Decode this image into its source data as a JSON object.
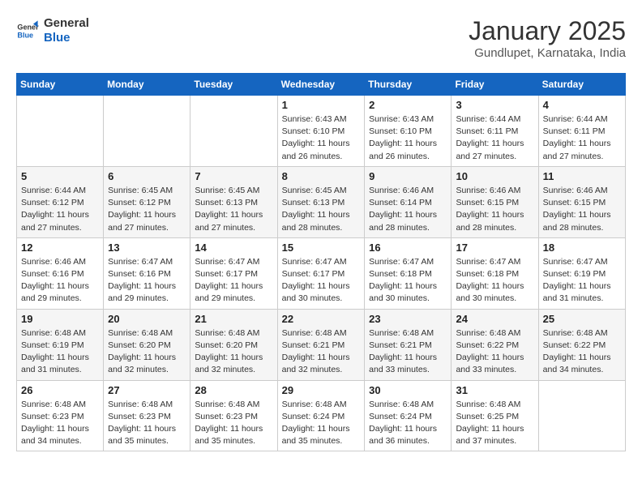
{
  "logo": {
    "line1": "General",
    "line2": "Blue"
  },
  "title": "January 2025",
  "subtitle": "Gundlupet, Karnataka, India",
  "days_of_week": [
    "Sunday",
    "Monday",
    "Tuesday",
    "Wednesday",
    "Thursday",
    "Friday",
    "Saturday"
  ],
  "weeks": [
    [
      {
        "day": "",
        "info": ""
      },
      {
        "day": "",
        "info": ""
      },
      {
        "day": "",
        "info": ""
      },
      {
        "day": "1",
        "info": "Sunrise: 6:43 AM\nSunset: 6:10 PM\nDaylight: 11 hours and 26 minutes."
      },
      {
        "day": "2",
        "info": "Sunrise: 6:43 AM\nSunset: 6:10 PM\nDaylight: 11 hours and 26 minutes."
      },
      {
        "day": "3",
        "info": "Sunrise: 6:44 AM\nSunset: 6:11 PM\nDaylight: 11 hours and 27 minutes."
      },
      {
        "day": "4",
        "info": "Sunrise: 6:44 AM\nSunset: 6:11 PM\nDaylight: 11 hours and 27 minutes."
      }
    ],
    [
      {
        "day": "5",
        "info": "Sunrise: 6:44 AM\nSunset: 6:12 PM\nDaylight: 11 hours and 27 minutes."
      },
      {
        "day": "6",
        "info": "Sunrise: 6:45 AM\nSunset: 6:12 PM\nDaylight: 11 hours and 27 minutes."
      },
      {
        "day": "7",
        "info": "Sunrise: 6:45 AM\nSunset: 6:13 PM\nDaylight: 11 hours and 27 minutes."
      },
      {
        "day": "8",
        "info": "Sunrise: 6:45 AM\nSunset: 6:13 PM\nDaylight: 11 hours and 28 minutes."
      },
      {
        "day": "9",
        "info": "Sunrise: 6:46 AM\nSunset: 6:14 PM\nDaylight: 11 hours and 28 minutes."
      },
      {
        "day": "10",
        "info": "Sunrise: 6:46 AM\nSunset: 6:15 PM\nDaylight: 11 hours and 28 minutes."
      },
      {
        "day": "11",
        "info": "Sunrise: 6:46 AM\nSunset: 6:15 PM\nDaylight: 11 hours and 28 minutes."
      }
    ],
    [
      {
        "day": "12",
        "info": "Sunrise: 6:46 AM\nSunset: 6:16 PM\nDaylight: 11 hours and 29 minutes."
      },
      {
        "day": "13",
        "info": "Sunrise: 6:47 AM\nSunset: 6:16 PM\nDaylight: 11 hours and 29 minutes."
      },
      {
        "day": "14",
        "info": "Sunrise: 6:47 AM\nSunset: 6:17 PM\nDaylight: 11 hours and 29 minutes."
      },
      {
        "day": "15",
        "info": "Sunrise: 6:47 AM\nSunset: 6:17 PM\nDaylight: 11 hours and 30 minutes."
      },
      {
        "day": "16",
        "info": "Sunrise: 6:47 AM\nSunset: 6:18 PM\nDaylight: 11 hours and 30 minutes."
      },
      {
        "day": "17",
        "info": "Sunrise: 6:47 AM\nSunset: 6:18 PM\nDaylight: 11 hours and 30 minutes."
      },
      {
        "day": "18",
        "info": "Sunrise: 6:47 AM\nSunset: 6:19 PM\nDaylight: 11 hours and 31 minutes."
      }
    ],
    [
      {
        "day": "19",
        "info": "Sunrise: 6:48 AM\nSunset: 6:19 PM\nDaylight: 11 hours and 31 minutes."
      },
      {
        "day": "20",
        "info": "Sunrise: 6:48 AM\nSunset: 6:20 PM\nDaylight: 11 hours and 32 minutes."
      },
      {
        "day": "21",
        "info": "Sunrise: 6:48 AM\nSunset: 6:20 PM\nDaylight: 11 hours and 32 minutes."
      },
      {
        "day": "22",
        "info": "Sunrise: 6:48 AM\nSunset: 6:21 PM\nDaylight: 11 hours and 32 minutes."
      },
      {
        "day": "23",
        "info": "Sunrise: 6:48 AM\nSunset: 6:21 PM\nDaylight: 11 hours and 33 minutes."
      },
      {
        "day": "24",
        "info": "Sunrise: 6:48 AM\nSunset: 6:22 PM\nDaylight: 11 hours and 33 minutes."
      },
      {
        "day": "25",
        "info": "Sunrise: 6:48 AM\nSunset: 6:22 PM\nDaylight: 11 hours and 34 minutes."
      }
    ],
    [
      {
        "day": "26",
        "info": "Sunrise: 6:48 AM\nSunset: 6:23 PM\nDaylight: 11 hours and 34 minutes."
      },
      {
        "day": "27",
        "info": "Sunrise: 6:48 AM\nSunset: 6:23 PM\nDaylight: 11 hours and 35 minutes."
      },
      {
        "day": "28",
        "info": "Sunrise: 6:48 AM\nSunset: 6:23 PM\nDaylight: 11 hours and 35 minutes."
      },
      {
        "day": "29",
        "info": "Sunrise: 6:48 AM\nSunset: 6:24 PM\nDaylight: 11 hours and 35 minutes."
      },
      {
        "day": "30",
        "info": "Sunrise: 6:48 AM\nSunset: 6:24 PM\nDaylight: 11 hours and 36 minutes."
      },
      {
        "day": "31",
        "info": "Sunrise: 6:48 AM\nSunset: 6:25 PM\nDaylight: 11 hours and 37 minutes."
      },
      {
        "day": "",
        "info": ""
      }
    ]
  ]
}
